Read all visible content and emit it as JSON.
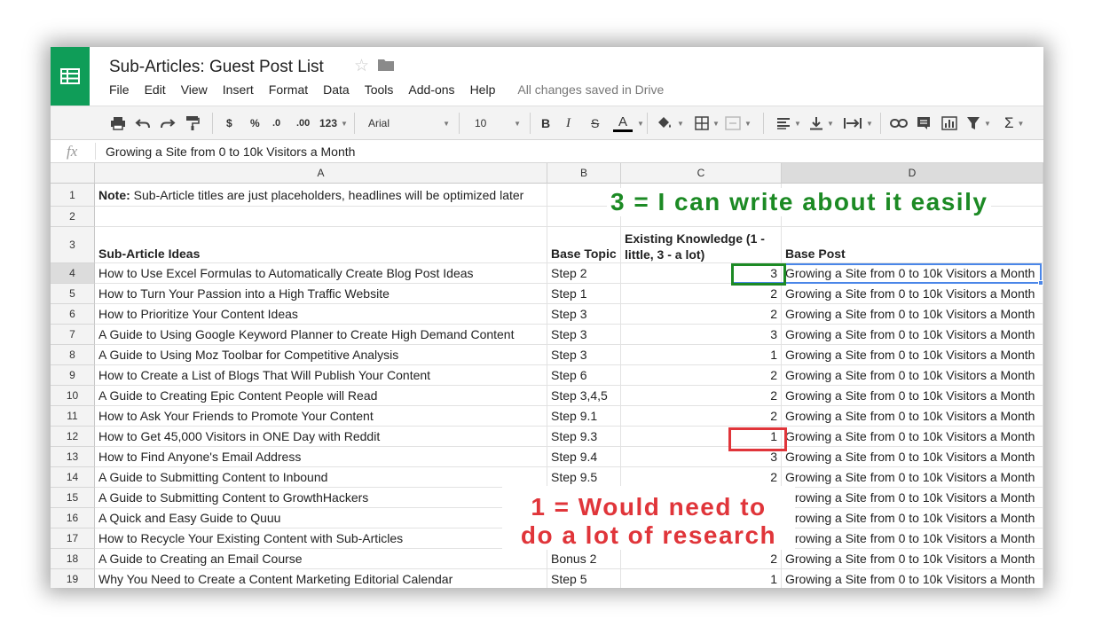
{
  "doc": {
    "title": "Sub-Articles: Guest Post List",
    "saved_status": "All changes saved in Drive"
  },
  "menu": [
    "File",
    "Edit",
    "View",
    "Insert",
    "Format",
    "Data",
    "Tools",
    "Add-ons",
    "Help"
  ],
  "toolbar": {
    "currency": "$",
    "percent": "%",
    "decrease_decimal": ".0",
    "increase_decimal": ".00",
    "more_formats": "123",
    "font": "Arial",
    "font_size": "10",
    "bold": "B",
    "italic": "I",
    "strike": "S",
    "text_color": "A",
    "sum": "Σ"
  },
  "formula": {
    "fx": "fx",
    "value": "Growing a Site from 0 to 10k Visitors a Month"
  },
  "columns": [
    "A",
    "B",
    "C",
    "D"
  ],
  "sheet": {
    "row1": {
      "note_label": "Note:",
      "note_text": " Sub-Article titles are just placeholders, headlines will be optimized later"
    },
    "headers": {
      "a": "Sub-Article Ideas",
      "b": "Base Topic",
      "c": "Existing Knowledge (1 - little, 3 - a lot)",
      "d": "Base Post"
    },
    "rows": [
      {
        "n": "4",
        "idea": "How to Use Excel Formulas to Automatically Create Blog Post Ideas",
        "topic": "Step 2",
        "knowledge": "3",
        "post": "Growing a Site from 0 to 10k Visitors a Month"
      },
      {
        "n": "5",
        "idea": "How to Turn Your Passion into a High Traffic Website",
        "topic": "Step 1",
        "knowledge": "2",
        "post": "Growing a Site from 0 to 10k Visitors a Month"
      },
      {
        "n": "6",
        "idea": "How to Prioritize Your Content Ideas",
        "topic": "Step 3",
        "knowledge": "2",
        "post": "Growing a Site from 0 to 10k Visitors a Month"
      },
      {
        "n": "7",
        "idea": "A Guide to Using Google Keyword Planner to Create High Demand Content",
        "topic": "Step 3",
        "knowledge": "3",
        "post": "Growing a Site from 0 to 10k Visitors a Month"
      },
      {
        "n": "8",
        "idea": "A Guide to Using Moz Toolbar for Competitive Analysis",
        "topic": "Step 3",
        "knowledge": "1",
        "post": "Growing a Site from 0 to 10k Visitors a Month"
      },
      {
        "n": "9",
        "idea": "How to Create a List of Blogs That Will Publish Your Content",
        "topic": "Step 6",
        "knowledge": "2",
        "post": "Growing a Site from 0 to 10k Visitors a Month"
      },
      {
        "n": "10",
        "idea": "A Guide to Creating Epic Content People will Read",
        "topic": "Step 3,4,5",
        "knowledge": "2",
        "post": "Growing a Site from 0 to 10k Visitors a Month"
      },
      {
        "n": "11",
        "idea": "How to Ask Your Friends to Promote Your Content",
        "topic": "Step 9.1",
        "knowledge": "2",
        "post": "Growing a Site from 0 to 10k Visitors a Month"
      },
      {
        "n": "12",
        "idea": "How to Get 45,000 Visitors in ONE Day with Reddit",
        "topic": "Step 9.3",
        "knowledge": "1",
        "post": "Growing a Site from 0 to 10k Visitors a Month"
      },
      {
        "n": "13",
        "idea": "How to Find Anyone's Email Address",
        "topic": "Step 9.4",
        "knowledge": "3",
        "post": "Growing a Site from 0 to 10k Visitors a Month"
      },
      {
        "n": "14",
        "idea": "A Guide to Submitting Content to Inbound",
        "topic": "Step 9.5",
        "knowledge": "2",
        "post": "Growing a Site from 0 to 10k Visitors a Month"
      },
      {
        "n": "15",
        "idea": "A Guide to Submitting Content to GrowthHackers",
        "topic": "",
        "knowledge": "",
        "post": "Growing a Site from 0 to 10k Visitors a Month"
      },
      {
        "n": "16",
        "idea": "A Quick and Easy Guide to Quuu",
        "topic": "",
        "knowledge": "",
        "post": "Growing a Site from 0 to 10k Visitors a Month"
      },
      {
        "n": "17",
        "idea": "How to Recycle Your Existing Content with Sub-Articles",
        "topic": "",
        "knowledge": "",
        "post": "Growing a Site from 0 to 10k Visitors a Month"
      },
      {
        "n": "18",
        "idea": "A Guide to Creating an Email Course",
        "topic": "Bonus 2",
        "knowledge": "2",
        "post": "Growing a Site from 0 to 10k Visitors a Month"
      },
      {
        "n": "19",
        "idea": "Why You Need to Create a Content Marketing Editorial Calendar",
        "topic": "Step 5",
        "knowledge": "1",
        "post": "Growing a Site from 0 to 10k Visitors a Month"
      }
    ]
  },
  "annotations": {
    "green": "3 = I can write about it easily",
    "red_line1": "1 = Would need to",
    "red_line2": "do a lot of research",
    "green_color": "#1c8a24",
    "red_color": "#e0353a"
  },
  "colors": {
    "brand": "#0f9d58",
    "selection": "#4a86e8"
  }
}
